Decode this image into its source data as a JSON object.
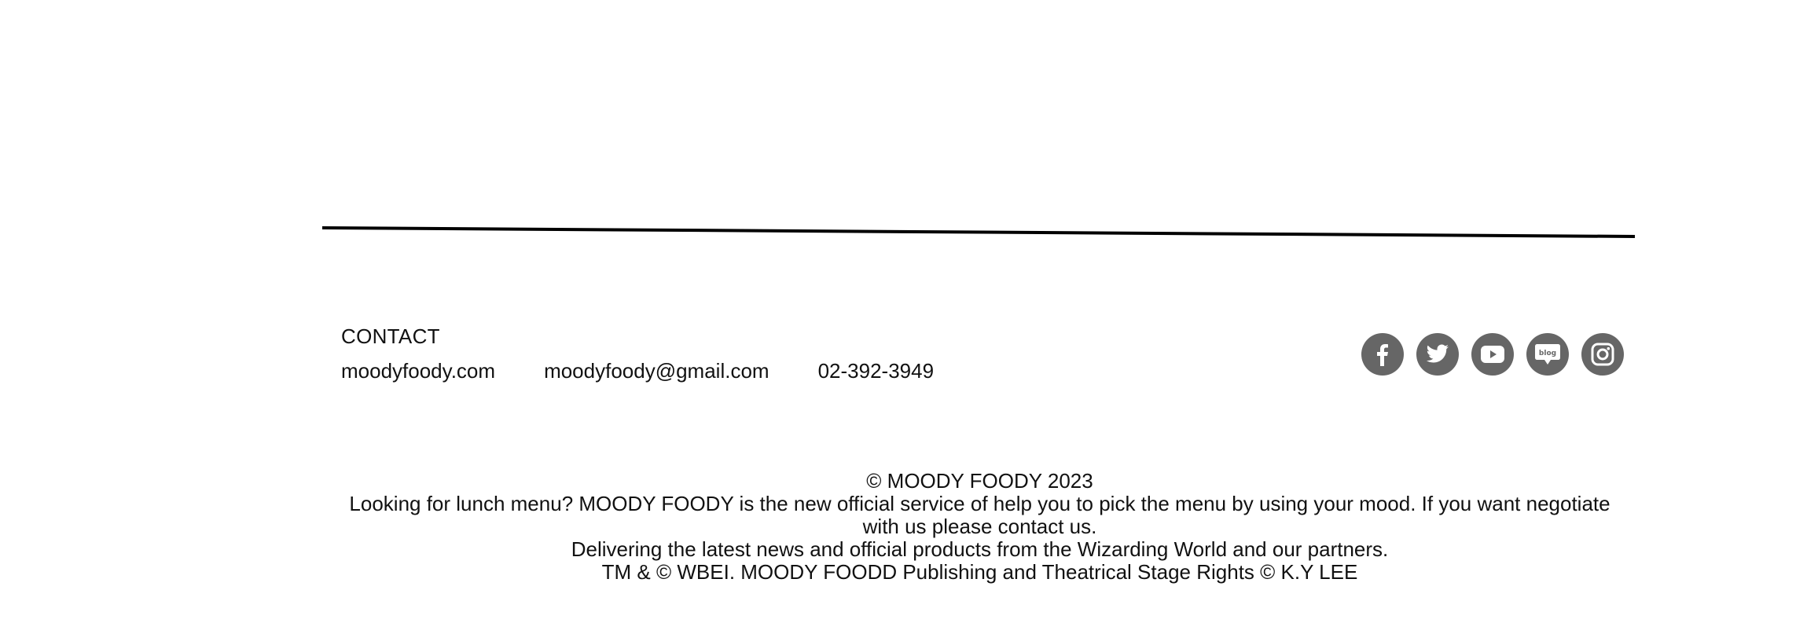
{
  "contact": {
    "heading": "CONTACT",
    "website": "moodyfoody.com",
    "email": "moodyfoody@gmail.com",
    "phone": "02-392-3949"
  },
  "social": [
    {
      "name": "facebook-icon",
      "label": "f"
    },
    {
      "name": "twitter-icon",
      "label": "twitter"
    },
    {
      "name": "youtube-icon",
      "label": "youtube"
    },
    {
      "name": "blog-icon",
      "label": "blog"
    },
    {
      "name": "instagram-icon",
      "label": "instagram"
    }
  ],
  "footer": {
    "copyright": "© MOODY FOODY 2023",
    "description": "Looking for lunch menu? MOODY FOODY is the new official service of help you to pick the menu by using your mood. If you want negotiate with us please contact us.",
    "news": "Delivering the latest news and official products from the Wizarding World and our partners.",
    "rights": "TM & © WBEI.  MOODY FOODD Publishing and Theatrical Stage Rights © K.Y LEE"
  },
  "colors": {
    "icon_bg": "#666666",
    "text": "#111111",
    "line": "#000000"
  }
}
